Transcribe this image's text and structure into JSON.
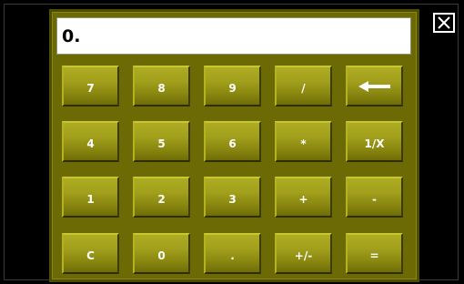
{
  "display": {
    "value": "0."
  },
  "close": {
    "icon": "close-icon"
  },
  "keys": {
    "row1": [
      "7",
      "8",
      "9",
      "/",
      ""
    ],
    "row2": [
      "4",
      "5",
      "6",
      "*",
      "1/X"
    ],
    "row3": [
      "1",
      "2",
      "3",
      "+",
      "-"
    ],
    "row4": [
      "C",
      "0",
      ".",
      "+/-",
      "="
    ]
  },
  "icons": {
    "backspace": "backspace-arrow-icon"
  },
  "colors": {
    "panel": "#6b6a05",
    "key_top": "#aeac22",
    "key_bottom": "#6f6d06",
    "key_text": "#ffffff",
    "background": "#000000"
  }
}
